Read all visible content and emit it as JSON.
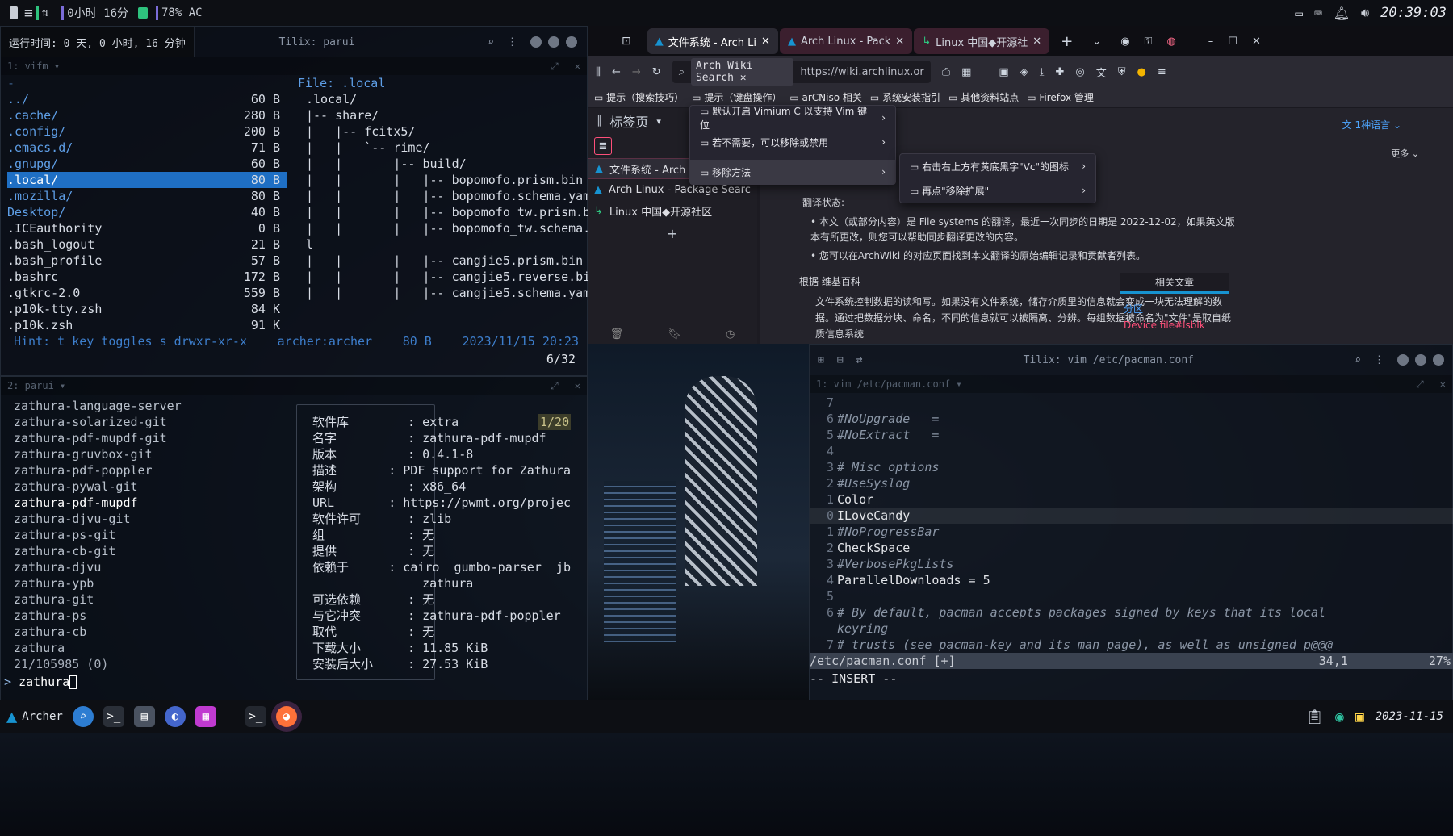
{
  "topbar": {
    "uptime_short": "0小时 16分",
    "battery": "78% AC",
    "clock": "20:39:03"
  },
  "term1": {
    "uptime": "运行时间: 0 天, 0 小时, 16 分钟",
    "title": "Tilix: parui",
    "pane_label": "1: vifm",
    "file_header": "File: .local",
    "files": [
      {
        "name": "../",
        "size": "60 B",
        "cls": "blue"
      },
      {
        "name": ".cache/",
        "size": "280 B",
        "cls": "blue"
      },
      {
        "name": ".config/",
        "size": "200 B",
        "cls": "blue"
      },
      {
        "name": ".emacs.d/",
        "size": "71 B",
        "cls": "blue"
      },
      {
        "name": ".gnupg/",
        "size": "60 B",
        "cls": "blue"
      },
      {
        "name": ".local/",
        "size": "80 B",
        "cls": "sel"
      },
      {
        "name": ".mozilla/",
        "size": "80 B",
        "cls": "blue"
      },
      {
        "name": "Desktop/",
        "size": "40 B",
        "cls": "blue"
      },
      {
        "name": ".ICEauthority",
        "size": "0 B",
        "cls": "white"
      },
      {
        "name": ".bash_logout",
        "size": "21 B",
        "cls": "white"
      },
      {
        "name": ".bash_profile",
        "size": "57 B",
        "cls": "white"
      },
      {
        "name": ".bashrc",
        "size": "172 B",
        "cls": "white"
      },
      {
        "name": ".gtkrc-2.0",
        "size": "559 B",
        "cls": "white"
      },
      {
        "name": ".p10k-tty.zsh",
        "size": "84 K",
        "cls": "white"
      },
      {
        "name": ".p10k.zsh",
        "size": "91 K",
        "cls": "white"
      }
    ],
    "tree": [
      ".local/",
      "|-- share/",
      "|   |-- fcitx5/",
      "|   |   `-- rime/",
      "|   |       |-- build/",
      "|   |       |   |-- bopomofo.prism.bin",
      "|   |       |   |-- bopomofo.schema.yaml",
      "|   |       |   |-- bopomofo_tw.prism.bin",
      "|   |       |   |-- bopomofo_tw.schema.yam",
      "l",
      "|   |       |   |-- cangjie5.prism.bin",
      "|   |       |   |-- cangjie5.reverse.bin",
      "|   |       |   |-- cangjie5.schema.yaml"
    ],
    "status_left": "Hint: t key toggles s drwxr-xr-x",
    "status_user": "archer:archer",
    "status_size": "80 B",
    "status_date": "2023/11/15 20:23",
    "counter": "6/32"
  },
  "term2": {
    "pane_label": "2: parui",
    "packages": [
      "zathura-language-server",
      "zathura-solarized-git",
      "zathura-pdf-mupdf-git",
      "zathura-gruvbox-git",
      "zathura-pdf-poppler",
      "zathura-pywal-git",
      "zathura-pdf-mupdf",
      "zathura-djvu-git",
      "zathura-ps-git",
      "zathura-cb-git",
      "zathura-djvu",
      "zathura-ypb",
      "zathura-git",
      "zathura-ps",
      "zathura-cb",
      "zathura"
    ],
    "selected_index": 6,
    "count": "21/105985 (0)",
    "prompt": "zathura",
    "badge": "1/20",
    "info": [
      {
        "k": "软件库",
        "v": "extra"
      },
      {
        "k": "名字",
        "v": "zathura-pdf-mupdf"
      },
      {
        "k": "版本",
        "v": "0.4.1-8"
      },
      {
        "k": "描述",
        "v": "PDF support for Zathura"
      },
      {
        "k": "架构",
        "v": "x86_64"
      },
      {
        "k": "URL",
        "v": "https://pwmt.org/projec"
      },
      {
        "k": "软件许可",
        "v": "zlib"
      },
      {
        "k": "组",
        "v": "无"
      },
      {
        "k": "提供",
        "v": "无"
      },
      {
        "k": "依赖于",
        "v": "cairo  gumbo-parser  jb"
      },
      {
        "k": "",
        "v": "zathura"
      },
      {
        "k": "可选依赖",
        "v": "无"
      },
      {
        "k": "与它冲突",
        "v": "zathura-pdf-poppler"
      },
      {
        "k": "取代",
        "v": "无"
      },
      {
        "k": "下载大小",
        "v": "11.85 KiB"
      },
      {
        "k": "安装后大小",
        "v": "27.53 KiB"
      }
    ]
  },
  "firefox": {
    "tabs": [
      {
        "label": "文件系统 - Arch Li"
      },
      {
        "label": "Arch Linux - Pack"
      },
      {
        "label": "Linux 中国◆开源社"
      }
    ],
    "search_chip": "Arch Wiki Search",
    "url": "https://wiki.archlinux.or",
    "bookmarks": [
      "提示（搜索技巧）",
      "提示（键盘操作）",
      "arCNiso 相关",
      "系统安装指引",
      "其他资料站点",
      "Firefox 管理"
    ],
    "sidebar_title": "标签页",
    "sidebar_items": [
      "文件系统 - Arch",
      "Arch Linux - Package Searc",
      "Linux 中国◆开源社区"
    ],
    "menu1": [
      "默认开启 Vimium C 以支持 Vim 键位",
      "若不需要，可以移除或禁用",
      "移除方法"
    ],
    "menu2": [
      "右击右上方有黄底黑字\"Vc\"的图标",
      "再点\"移除扩展\""
    ],
    "lang": "1种语言",
    "more": "更多",
    "translation_title": "翻译状态:",
    "bullet1": "本文（或部分内容）是 File systems 的翻译，最近一次同步的日期是 2022-12-02，如果英文版本有所更改，则您可以帮助同步翻译更改的内容。",
    "bullet2": "您可以在ArchWiki 的对应页面找到本文翻译的原始编辑记录和贡献者列表。",
    "based": "根据 维基百科",
    "para": "文件系统控制数据的读和写。如果没有文件系统，储存介质里的信息就会变成一块无法理解的数据。通过把数据分块、命名，不同的信息就可以被隔离、分辨。每组数据被命名为\"文件\"是取自纸质信息系统",
    "related_title": "相关文章",
    "related_1": "分区",
    "related_2": "Device file#lsblk"
  },
  "vim": {
    "title": "Tilix: vim /etc/pacman.conf",
    "pane_label": "1: vim /etc/pacman.conf",
    "lines": [
      {
        "n": "7",
        "t": "",
        "c": "cm"
      },
      {
        "n": "6",
        "t": "#NoUpgrade   =",
        "c": "cm"
      },
      {
        "n": "5",
        "t": "#NoExtract   =",
        "c": "cm"
      },
      {
        "n": "4",
        "t": "",
        "c": "cm"
      },
      {
        "n": "3",
        "t": "# Misc options",
        "c": "cm"
      },
      {
        "n": "2",
        "t": "#UseSyslog",
        "c": "cm"
      },
      {
        "n": "1",
        "t": "Color",
        "c": "tx"
      },
      {
        "n": "0",
        "t": "ILoveCandy",
        "c": "tx"
      },
      {
        "n": "1",
        "t": "#NoProgressBar",
        "c": "cm"
      },
      {
        "n": "2",
        "t": "CheckSpace",
        "c": "tx"
      },
      {
        "n": "3",
        "t": "#VerbosePkgLists",
        "c": "cm"
      },
      {
        "n": "4",
        "t": "ParallelDownloads = 5",
        "c": "tx"
      },
      {
        "n": "5",
        "t": "",
        "c": "cm"
      },
      {
        "n": "6",
        "t": "# By default, pacman accepts packages signed by keys that its local",
        "c": "cm"
      },
      {
        "n": "",
        "t": "keyring",
        "c": "cm"
      },
      {
        "n": "7",
        "t": "# trusts (see pacman-key and its man page), as well as unsigned p@@@",
        "c": "cm"
      }
    ],
    "status_file": "/etc/pacman.conf [+]",
    "status_pos": "34,1",
    "status_pct": "27%",
    "mode": "-- INSERT --"
  },
  "taskbar": {
    "user": "Archer",
    "date": "2023-11-15"
  }
}
